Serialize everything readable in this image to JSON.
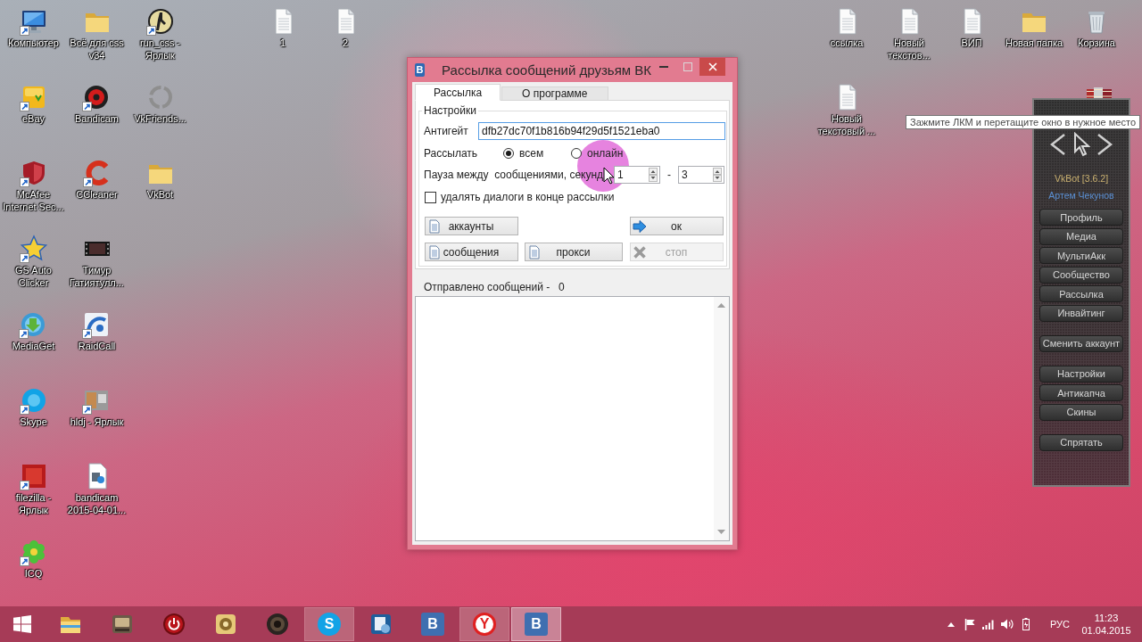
{
  "desktop": {
    "icon_groups": [
      {
        "columns": [
          {
            "icons": [
              {
                "label": "Компьютер",
                "kind": "monitor",
                "shortcut": true
              },
              {
                "label": "eBay",
                "kind": "tile",
                "shortcut": true
              },
              {
                "label": "McAfee Internet Sec...",
                "kind": "shield",
                "shortcut": true
              },
              {
                "label": "GS Auto Clicker",
                "kind": "star",
                "shortcut": true
              },
              {
                "label": "MediaGet",
                "kind": "globe",
                "shortcut": true
              },
              {
                "label": "Skype",
                "kind": "bubble",
                "shortcut": true
              },
              {
                "label": "filezilla - Ярлык",
                "kind": "square",
                "shortcut": true
              },
              {
                "label": "ICQ",
                "kind": "flower",
                "shortcut": true
              }
            ]
          },
          {
            "icons": [
              {
                "label": "Всё для css v34",
                "kind": "folder",
                "shortcut": false
              },
              {
                "label": "Bandicam",
                "kind": "disc",
                "shortcut": true
              },
              {
                "label": "CCleaner",
                "kind": "arc",
                "shortcut": true
              },
              {
                "label": "Тимур Гатиятулл...",
                "kind": "film",
                "shortcut": false
              },
              {
                "label": "RaidCall",
                "kind": "swirl",
                "shortcut": true
              },
              {
                "label": "hldj - Ярлык",
                "kind": "window",
                "shortcut": true
              },
              {
                "label": "bandicam 2015-04-01...",
                "kind": "media",
                "shortcut": false
              }
            ]
          },
          {
            "icons": [
              {
                "label": "run_css - Ярлык",
                "kind": "figure",
                "shortcut": true
              },
              {
                "label": "VkFriends...",
                "kind": "ring",
                "shortcut": false
              },
              {
                "label": "VkBot",
                "kind": "folder",
                "shortcut": false
              }
            ]
          }
        ]
      },
      {
        "columns": [
          {
            "icons": [
              {
                "label": "1",
                "kind": "document",
                "shortcut": false
              }
            ]
          },
          {
            "icons": [
              {
                "label": "2",
                "kind": "document",
                "shortcut": false
              }
            ]
          }
        ]
      },
      {
        "columns": [
          {
            "icons": [
              {
                "label": "ссылка",
                "kind": "document",
                "shortcut": false
              },
              {
                "label": "Новый текстовый ...",
                "kind": "document",
                "shortcut": false
              }
            ]
          },
          {
            "icons": [
              {
                "label": "Новый текстов...",
                "kind": "document",
                "shortcut": false
              }
            ]
          },
          {
            "icons": [
              {
                "label": "ВИП",
                "kind": "document",
                "shortcut": false
              }
            ]
          },
          {
            "icons": [
              {
                "label": "Новая папка",
                "kind": "folder",
                "shortcut": false
              }
            ]
          },
          {
            "icons": [
              {
                "label": "Корзина",
                "kind": "bin",
                "shortcut": false
              }
            ]
          }
        ]
      }
    ]
  },
  "dialog": {
    "title": "Рассылка сообщений друзьям ВК",
    "app_glyph": "B",
    "tabs": [
      {
        "label": "Рассылка",
        "selected": true
      },
      {
        "label": "О программе",
        "selected": false
      }
    ],
    "group_title": "Настройки",
    "antigate": {
      "label": "Антигейт",
      "value": "dfb27dc70f1b816b94f29d5f1521eba0",
      "focused": true
    },
    "send_to": {
      "label": "Рассылать",
      "options": [
        {
          "label": "всем",
          "selected": true
        },
        {
          "label": "онлайн",
          "selected": false
        }
      ]
    },
    "pause": {
      "label": "Пауза между  сообщениями, секунд",
      "from": "1",
      "separator": "-",
      "to": "3"
    },
    "delete_dialogs": {
      "label": "удалять диалоги в конце рассылки",
      "checked": false
    },
    "buttons": [
      {
        "label": "аккаунты",
        "kind": "document",
        "disabled": false
      },
      {
        "label": "ок",
        "kind": "arrow",
        "disabled": false
      },
      {
        "label": "сообщения",
        "kind": "document",
        "disabled": false
      },
      {
        "label": "прокси",
        "kind": "document",
        "disabled": false
      },
      {
        "label": "стоп",
        "kind": "cross",
        "disabled": true
      }
    ],
    "sent_label": "Отправлено сообщений -",
    "sent_count": "0"
  },
  "vkbot": {
    "tooltip": "Зажмите ЛКМ и перетащите окно в нужное место",
    "version": "VkBot [3.6.2]",
    "user": "Артем Чекунов",
    "menu": [
      {
        "items": [
          "Профиль",
          "Медиа",
          "МультиАкк",
          "Сообщество",
          "Рассылка",
          "Инвайтинг"
        ]
      },
      {
        "items": [
          "Сменить аккаунт"
        ]
      },
      {
        "items": [
          "Настройки",
          "Антикапча",
          "Скины"
        ]
      },
      {
        "items": [
          "Спрятать"
        ]
      }
    ]
  },
  "taskbar": {
    "apps": [
      {
        "kind": "folder",
        "running": false,
        "selected": false
      },
      {
        "kind": "box",
        "running": false,
        "selected": false
      },
      {
        "kind": "power",
        "running": false,
        "selected": false
      },
      {
        "kind": "disc",
        "running": false,
        "selected": false
      },
      {
        "kind": "speaker",
        "running": false,
        "selected": false
      },
      {
        "kind": "bubble",
        "glyph": "S",
        "running": true,
        "selected": false
      },
      {
        "kind": "gear",
        "running": false,
        "selected": false
      },
      {
        "kind": "tile",
        "glyph": "B",
        "running": false,
        "selected": false
      },
      {
        "kind": "circle",
        "glyph": "Y",
        "running": true,
        "selected": false
      },
      {
        "kind": "tile",
        "glyph": "B",
        "running": true,
        "selected": true
      }
    ],
    "language": "РУС",
    "time": "11:23",
    "date": "01.04.2015"
  }
}
